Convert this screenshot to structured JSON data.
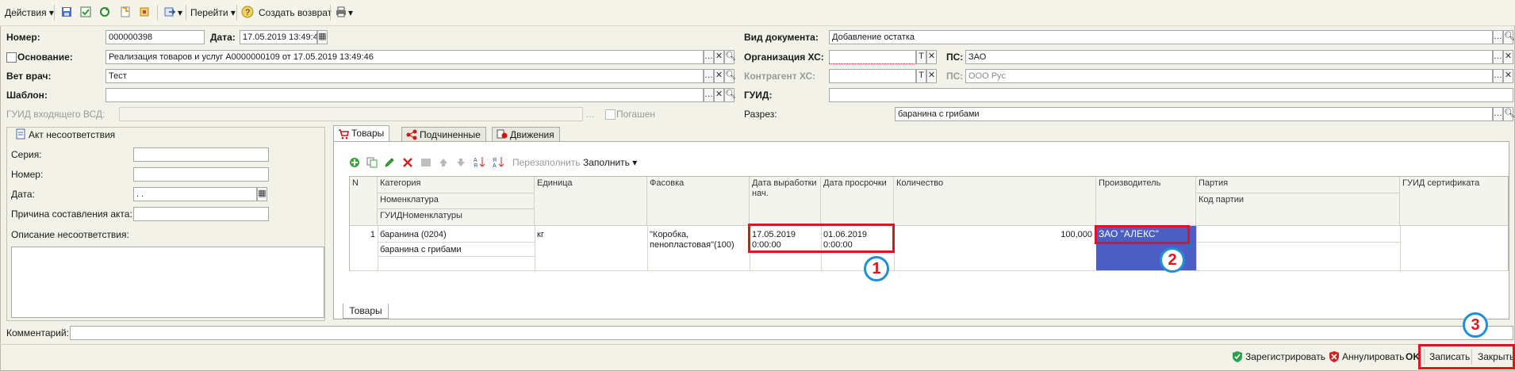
{
  "toolbar": {
    "actions": "Действия",
    "goto": "Перейти",
    "create_return": "Создать возврат"
  },
  "header": {
    "number_label": "Номер:",
    "number_value": "000000398",
    "date_label": "Дата:",
    "date_value": "17.05.2019 13:49:4",
    "basis_label": "Основание:",
    "basis_value": "Реализация товаров и услуг А0000000109 от 17.05.2019 13:49:46",
    "vet_label": "Вет врач:",
    "vet_value": "Тест",
    "template_label": "Шаблон:",
    "template_value": "",
    "guid_incoming_label": "ГУИД входящего ВСД:",
    "repaid_label": "Погашен",
    "doc_type_label": "Вид документа:",
    "doc_type_value": "Добавление остатка",
    "org_label": "Организация ХС:",
    "org_value": "",
    "ps_label": "ПС:",
    "ps_value": "ЗАО",
    "counterparty_label": "Контрагент ХС:",
    "counterparty_value": "",
    "ps2_label": "ПС:",
    "ps2_value": "ООО Рус",
    "guid_label": "ГУИД:",
    "guid_value": "",
    "cut_label": "Разрез:",
    "cut_value": "баранина с грибами"
  },
  "act_panel": {
    "title": "Акт несоответствия",
    "series_label": "Серия:",
    "number_label": "Номер:",
    "date_label": "Дата:",
    "date_value": " .  .",
    "reason_label": "Причина составления акта:",
    "description_label": "Описание несоответствия:"
  },
  "tabs": [
    "Товары",
    "Подчиненные",
    "Движения"
  ],
  "grid_toolbar": {
    "refill": "Перезаполнить",
    "fill": "Заполнить"
  },
  "table": {
    "headers": {
      "n": "N",
      "category": "Категория",
      "nomenclature": "Номенклатура",
      "guid_nomenclature": "ГУИДНоменклатуры",
      "unit": "Единица",
      "packaging": "Фасовка",
      "prod_date": "Дата выработки нач.",
      "expiry_date": "Дата просрочки",
      "quantity": "Количество",
      "producer": "Производитель",
      "batch": "Партия",
      "batch_code": "Код партии",
      "cert_guid": "ГУИД сертификата"
    },
    "rows": [
      {
        "n": "1",
        "category": "баранина (0204)",
        "nomenclature": "баранина с грибами",
        "unit": "кг",
        "packaging": "\"Коробка, пенопластовая\"(100)",
        "prod_date": "17.05.2019 0:00:00",
        "expiry_date": "01.06.2019 0:00:00",
        "quantity": "100,000",
        "producer": "ЗАО \"АЛЕКС\""
      }
    ],
    "bottom_tab": "Товары"
  },
  "comment_label": "Комментарий:",
  "footer": {
    "register": "Зарегистрировать",
    "cancel": "Аннулировать",
    "ok": "OK",
    "save": "Записать",
    "close": "Закрыть"
  },
  "annotations": [
    "1",
    "2",
    "3"
  ],
  "colors": {
    "highlight_red": "#e0141c",
    "circle_blue": "#1e90d6",
    "selection_blue": "#4a5fc1"
  }
}
